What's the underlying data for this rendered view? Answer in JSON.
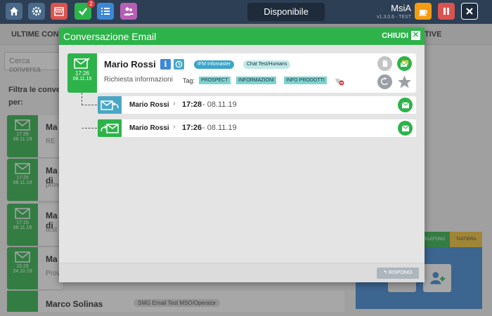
{
  "topbar": {
    "status": "Disponibile",
    "user": "MsiA",
    "version": "v1.3.0.6 - TEST",
    "tasks_badge": "2"
  },
  "background": {
    "tab_last": "ULTIME CONV",
    "tab_right": "TIVE",
    "search_placeholder": "Cerca conversa",
    "filter_line1": "Filtra le conver",
    "filter_line2": "per:",
    "cards": [
      {
        "name": "Ma",
        "sub": "RE",
        "time": "17:26",
        "date": "08.11.19"
      },
      {
        "name": "Ma di",
        "sub": "prov",
        "time": "17:25",
        "date": "08.11.19"
      },
      {
        "name": "Ma di",
        "sub": "test",
        "time": "17:15",
        "date": "08.11.19"
      },
      {
        "name": "Ma",
        "sub": "Prov",
        "time": "15:29",
        "date": "24.10.19"
      }
    ],
    "bottom_card": {
      "name": "Marco Solinas",
      "chip": "SMG Email Test MSO/Operator"
    },
    "right_tab_phone": "TELEFONO",
    "right_tab_keyboard": "TASTIERA"
  },
  "modal": {
    "title": "Conversazione Email",
    "close_label": "CHIUDI",
    "main": {
      "sender": "Mario Rossi",
      "subject": "Richiesta informazioni",
      "time": "17:26",
      "date": "08.11.19",
      "chips": [
        "IFM Infomaster",
        "Chat Test/Humans"
      ],
      "tag_label": "Tag:",
      "tags": [
        "PROSPECT",
        "INFORMAZIONI",
        "INFO PRODOTTI"
      ]
    },
    "replies": [
      {
        "name": "Mario Rossi",
        "time": "17:28",
        "date": " - 08.11.19",
        "direction": "incoming-reply"
      },
      {
        "name": "Mario Rossi",
        "time": "17:26",
        "date": " - 08.11.19",
        "direction": "forward"
      }
    ],
    "reply_button": "RISPONDI"
  },
  "colors": {
    "green": "#2db34a",
    "dark_header": "#2d3f54",
    "teal_tag": "#7ed4d0",
    "blue": "#3d88d6"
  }
}
